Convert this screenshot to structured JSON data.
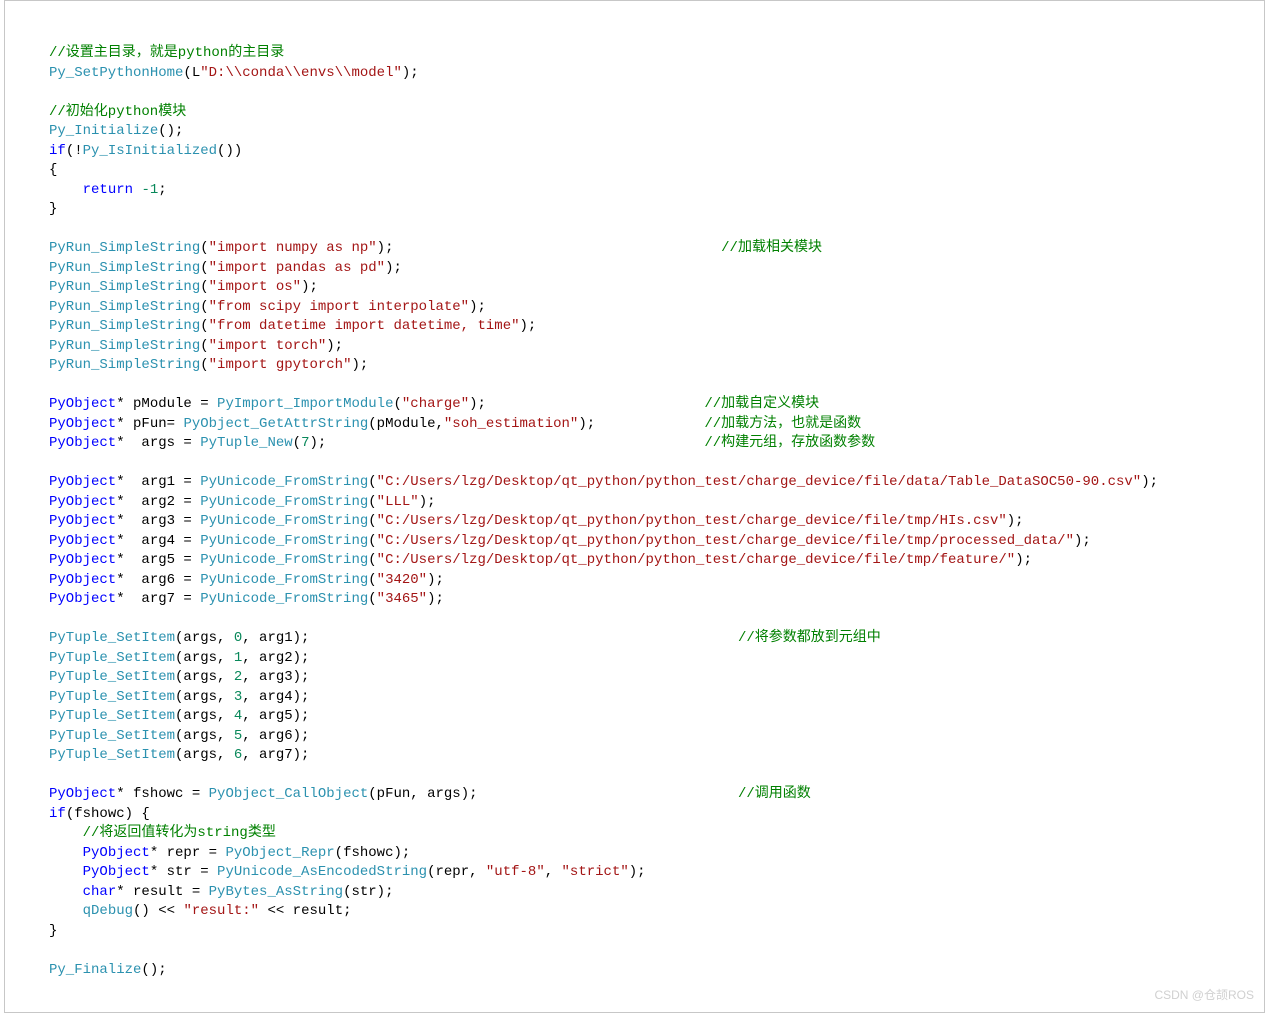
{
  "code": {
    "lines": [
      {
        "indent": 0,
        "parts": [
          {
            "cls": "cmt",
            "t": "//设置主目录，就是python的主目录"
          }
        ]
      },
      {
        "indent": 0,
        "parts": [
          {
            "cls": "fn",
            "t": "Py_SetPythonHome"
          },
          {
            "cls": "op",
            "t": "(L"
          },
          {
            "cls": "str",
            "t": "\"D:\\\\conda\\\\envs\\\\model\""
          },
          {
            "cls": "op",
            "t": ");"
          }
        ]
      },
      {
        "indent": 0,
        "parts": []
      },
      {
        "indent": 0,
        "parts": [
          {
            "cls": "cmt",
            "t": "//初始化python模块"
          }
        ]
      },
      {
        "indent": 0,
        "parts": [
          {
            "cls": "fn",
            "t": "Py_Initialize"
          },
          {
            "cls": "op",
            "t": "();"
          }
        ]
      },
      {
        "indent": 0,
        "parts": [
          {
            "cls": "typ",
            "t": "if"
          },
          {
            "cls": "op",
            "t": "(!"
          },
          {
            "cls": "fn",
            "t": "Py_IsInitialized"
          },
          {
            "cls": "op",
            "t": "())"
          }
        ]
      },
      {
        "indent": 0,
        "parts": [
          {
            "cls": "op",
            "t": "{"
          }
        ]
      },
      {
        "indent": 1,
        "parts": [
          {
            "cls": "typ",
            "t": "return"
          },
          {
            "cls": "op",
            "t": " "
          },
          {
            "cls": "num",
            "t": "-1"
          },
          {
            "cls": "op",
            "t": ";"
          }
        ]
      },
      {
        "indent": 0,
        "parts": [
          {
            "cls": "op",
            "t": "}"
          }
        ]
      },
      {
        "indent": 0,
        "parts": []
      },
      {
        "indent": 0,
        "parts": [
          {
            "cls": "fn",
            "t": "PyRun_SimpleString"
          },
          {
            "cls": "op",
            "t": "("
          },
          {
            "cls": "str",
            "t": "\"import numpy as np\""
          },
          {
            "cls": "op",
            "t": ");"
          }
        ],
        "trail": {
          "col": 80,
          "t": "//加载相关模块"
        }
      },
      {
        "indent": 0,
        "parts": [
          {
            "cls": "fn",
            "t": "PyRun_SimpleString"
          },
          {
            "cls": "op",
            "t": "("
          },
          {
            "cls": "str",
            "t": "\"import pandas as pd\""
          },
          {
            "cls": "op",
            "t": ");"
          }
        ]
      },
      {
        "indent": 0,
        "parts": [
          {
            "cls": "fn",
            "t": "PyRun_SimpleString"
          },
          {
            "cls": "op",
            "t": "("
          },
          {
            "cls": "str",
            "t": "\"import os\""
          },
          {
            "cls": "op",
            "t": ");"
          }
        ]
      },
      {
        "indent": 0,
        "parts": [
          {
            "cls": "fn",
            "t": "PyRun_SimpleString"
          },
          {
            "cls": "op",
            "t": "("
          },
          {
            "cls": "str",
            "t": "\"from scipy import interpolate\""
          },
          {
            "cls": "op",
            "t": ");"
          }
        ]
      },
      {
        "indent": 0,
        "parts": [
          {
            "cls": "fn",
            "t": "PyRun_SimpleString"
          },
          {
            "cls": "op",
            "t": "("
          },
          {
            "cls": "str",
            "t": "\"from datetime import datetime, time\""
          },
          {
            "cls": "op",
            "t": ");"
          }
        ]
      },
      {
        "indent": 0,
        "parts": [
          {
            "cls": "fn",
            "t": "PyRun_SimpleString"
          },
          {
            "cls": "op",
            "t": "("
          },
          {
            "cls": "str",
            "t": "\"import torch\""
          },
          {
            "cls": "op",
            "t": ");"
          }
        ]
      },
      {
        "indent": 0,
        "parts": [
          {
            "cls": "fn",
            "t": "PyRun_SimpleString"
          },
          {
            "cls": "op",
            "t": "("
          },
          {
            "cls": "str",
            "t": "\"import gpytorch\""
          },
          {
            "cls": "op",
            "t": ");"
          }
        ]
      },
      {
        "indent": 0,
        "parts": []
      },
      {
        "indent": 0,
        "parts": [
          {
            "cls": "typ",
            "t": "PyObject"
          },
          {
            "cls": "op",
            "t": "* pModule = "
          },
          {
            "cls": "fn",
            "t": "PyImport_ImportModule"
          },
          {
            "cls": "op",
            "t": "("
          },
          {
            "cls": "str",
            "t": "\"charge\""
          },
          {
            "cls": "op",
            "t": ");"
          }
        ],
        "trail": {
          "col": 78,
          "t": "//加载自定义模块"
        }
      },
      {
        "indent": 0,
        "parts": [
          {
            "cls": "typ",
            "t": "PyObject"
          },
          {
            "cls": "op",
            "t": "* pFun= "
          },
          {
            "cls": "fn",
            "t": "PyObject_GetAttrString"
          },
          {
            "cls": "op",
            "t": "(pModule,"
          },
          {
            "cls": "str",
            "t": "\"soh_estimation\""
          },
          {
            "cls": "op",
            "t": ");"
          }
        ],
        "trail": {
          "col": 78,
          "t": "//加载方法，也就是函数"
        }
      },
      {
        "indent": 0,
        "parts": [
          {
            "cls": "typ",
            "t": "PyObject"
          },
          {
            "cls": "op",
            "t": "*  args = "
          },
          {
            "cls": "fn",
            "t": "PyTuple_New"
          },
          {
            "cls": "op",
            "t": "("
          },
          {
            "cls": "num",
            "t": "7"
          },
          {
            "cls": "op",
            "t": ");"
          }
        ],
        "trail": {
          "col": 78,
          "t": "//构建元组，存放函数参数"
        }
      },
      {
        "indent": 0,
        "parts": []
      },
      {
        "indent": 0,
        "parts": [
          {
            "cls": "typ",
            "t": "PyObject"
          },
          {
            "cls": "op",
            "t": "*  arg1 = "
          },
          {
            "cls": "fn",
            "t": "PyUnicode_FromString"
          },
          {
            "cls": "op",
            "t": "("
          },
          {
            "cls": "str",
            "t": "\"C:/Users/lzg/Desktop/qt_python/python_test/charge_device/file/data/Table_DataSOC50-90.csv\""
          },
          {
            "cls": "op",
            "t": ");"
          }
        ]
      },
      {
        "indent": 0,
        "parts": [
          {
            "cls": "typ",
            "t": "PyObject"
          },
          {
            "cls": "op",
            "t": "*  arg2 = "
          },
          {
            "cls": "fn",
            "t": "PyUnicode_FromString"
          },
          {
            "cls": "op",
            "t": "("
          },
          {
            "cls": "str",
            "t": "\"LLL\""
          },
          {
            "cls": "op",
            "t": ");"
          }
        ]
      },
      {
        "indent": 0,
        "parts": [
          {
            "cls": "typ",
            "t": "PyObject"
          },
          {
            "cls": "op",
            "t": "*  arg3 = "
          },
          {
            "cls": "fn",
            "t": "PyUnicode_FromString"
          },
          {
            "cls": "op",
            "t": "("
          },
          {
            "cls": "str",
            "t": "\"C:/Users/lzg/Desktop/qt_python/python_test/charge_device/file/tmp/HIs.csv\""
          },
          {
            "cls": "op",
            "t": ");"
          }
        ]
      },
      {
        "indent": 0,
        "parts": [
          {
            "cls": "typ",
            "t": "PyObject"
          },
          {
            "cls": "op",
            "t": "*  arg4 = "
          },
          {
            "cls": "fn",
            "t": "PyUnicode_FromString"
          },
          {
            "cls": "op",
            "t": "("
          },
          {
            "cls": "str",
            "t": "\"C:/Users/lzg/Desktop/qt_python/python_test/charge_device/file/tmp/processed_data/\""
          },
          {
            "cls": "op",
            "t": ");"
          }
        ]
      },
      {
        "indent": 0,
        "parts": [
          {
            "cls": "typ",
            "t": "PyObject"
          },
          {
            "cls": "op",
            "t": "*  arg5 = "
          },
          {
            "cls": "fn",
            "t": "PyUnicode_FromString"
          },
          {
            "cls": "op",
            "t": "("
          },
          {
            "cls": "str",
            "t": "\"C:/Users/lzg/Desktop/qt_python/python_test/charge_device/file/tmp/feature/\""
          },
          {
            "cls": "op",
            "t": ");"
          }
        ]
      },
      {
        "indent": 0,
        "parts": [
          {
            "cls": "typ",
            "t": "PyObject"
          },
          {
            "cls": "op",
            "t": "*  arg6 = "
          },
          {
            "cls": "fn",
            "t": "PyUnicode_FromString"
          },
          {
            "cls": "op",
            "t": "("
          },
          {
            "cls": "str",
            "t": "\"3420\""
          },
          {
            "cls": "op",
            "t": ");"
          }
        ]
      },
      {
        "indent": 0,
        "parts": [
          {
            "cls": "typ",
            "t": "PyObject"
          },
          {
            "cls": "op",
            "t": "*  arg7 = "
          },
          {
            "cls": "fn",
            "t": "PyUnicode_FromString"
          },
          {
            "cls": "op",
            "t": "("
          },
          {
            "cls": "str",
            "t": "\"3465\""
          },
          {
            "cls": "op",
            "t": ");"
          }
        ]
      },
      {
        "indent": 0,
        "parts": []
      },
      {
        "indent": 0,
        "parts": [
          {
            "cls": "fn",
            "t": "PyTuple_SetItem"
          },
          {
            "cls": "op",
            "t": "(args, "
          },
          {
            "cls": "num",
            "t": "0"
          },
          {
            "cls": "op",
            "t": ", arg1);"
          }
        ],
        "trail": {
          "col": 82,
          "t": "//将参数都放到元组中"
        }
      },
      {
        "indent": 0,
        "parts": [
          {
            "cls": "fn",
            "t": "PyTuple_SetItem"
          },
          {
            "cls": "op",
            "t": "(args, "
          },
          {
            "cls": "num",
            "t": "1"
          },
          {
            "cls": "op",
            "t": ", arg2);"
          }
        ]
      },
      {
        "indent": 0,
        "parts": [
          {
            "cls": "fn",
            "t": "PyTuple_SetItem"
          },
          {
            "cls": "op",
            "t": "(args, "
          },
          {
            "cls": "num",
            "t": "2"
          },
          {
            "cls": "op",
            "t": ", arg3);"
          }
        ]
      },
      {
        "indent": 0,
        "parts": [
          {
            "cls": "fn",
            "t": "PyTuple_SetItem"
          },
          {
            "cls": "op",
            "t": "(args, "
          },
          {
            "cls": "num",
            "t": "3"
          },
          {
            "cls": "op",
            "t": ", arg4);"
          }
        ]
      },
      {
        "indent": 0,
        "parts": [
          {
            "cls": "fn",
            "t": "PyTuple_SetItem"
          },
          {
            "cls": "op",
            "t": "(args, "
          },
          {
            "cls": "num",
            "t": "4"
          },
          {
            "cls": "op",
            "t": ", arg5);"
          }
        ]
      },
      {
        "indent": 0,
        "parts": [
          {
            "cls": "fn",
            "t": "PyTuple_SetItem"
          },
          {
            "cls": "op",
            "t": "(args, "
          },
          {
            "cls": "num",
            "t": "5"
          },
          {
            "cls": "op",
            "t": ", arg6);"
          }
        ]
      },
      {
        "indent": 0,
        "parts": [
          {
            "cls": "fn",
            "t": "PyTuple_SetItem"
          },
          {
            "cls": "op",
            "t": "(args, "
          },
          {
            "cls": "num",
            "t": "6"
          },
          {
            "cls": "op",
            "t": ", arg7);"
          }
        ]
      },
      {
        "indent": 0,
        "parts": []
      },
      {
        "indent": 0,
        "parts": [
          {
            "cls": "typ",
            "t": "PyObject"
          },
          {
            "cls": "op",
            "t": "* fshowc = "
          },
          {
            "cls": "fn",
            "t": "PyObject_CallObject"
          },
          {
            "cls": "op",
            "t": "(pFun, args);"
          }
        ],
        "trail": {
          "col": 82,
          "t": "//调用函数"
        }
      },
      {
        "indent": 0,
        "parts": [
          {
            "cls": "typ",
            "t": "if"
          },
          {
            "cls": "op",
            "t": "(fshowc) {"
          }
        ]
      },
      {
        "indent": 1,
        "parts": [
          {
            "cls": "cmt",
            "t": "//将返回值转化为string类型"
          }
        ]
      },
      {
        "indent": 1,
        "parts": [
          {
            "cls": "typ",
            "t": "PyObject"
          },
          {
            "cls": "op",
            "t": "* repr = "
          },
          {
            "cls": "fn",
            "t": "PyObject_Repr"
          },
          {
            "cls": "op",
            "t": "(fshowc);"
          }
        ]
      },
      {
        "indent": 1,
        "parts": [
          {
            "cls": "typ",
            "t": "PyObject"
          },
          {
            "cls": "op",
            "t": "* str = "
          },
          {
            "cls": "fn",
            "t": "PyUnicode_AsEncodedString"
          },
          {
            "cls": "op",
            "t": "(repr, "
          },
          {
            "cls": "str",
            "t": "\"utf-8\""
          },
          {
            "cls": "op",
            "t": ", "
          },
          {
            "cls": "str",
            "t": "\"strict\""
          },
          {
            "cls": "op",
            "t": ");"
          }
        ]
      },
      {
        "indent": 1,
        "parts": [
          {
            "cls": "typ",
            "t": "char"
          },
          {
            "cls": "op",
            "t": "* result = "
          },
          {
            "cls": "fn",
            "t": "PyBytes_AsString"
          },
          {
            "cls": "op",
            "t": "(str);"
          }
        ]
      },
      {
        "indent": 1,
        "parts": [
          {
            "cls": "fn",
            "t": "qDebug"
          },
          {
            "cls": "op",
            "t": "() << "
          },
          {
            "cls": "str",
            "t": "\"result:\""
          },
          {
            "cls": "op",
            "t": " << result;"
          }
        ]
      },
      {
        "indent": 0,
        "parts": [
          {
            "cls": "op",
            "t": "}"
          }
        ]
      },
      {
        "indent": 0,
        "parts": []
      },
      {
        "indent": 0,
        "parts": [
          {
            "cls": "fn",
            "t": "Py_Finalize"
          },
          {
            "cls": "op",
            "t": "();"
          }
        ]
      }
    ]
  },
  "watermark": "CSDN @仓颉ROS"
}
